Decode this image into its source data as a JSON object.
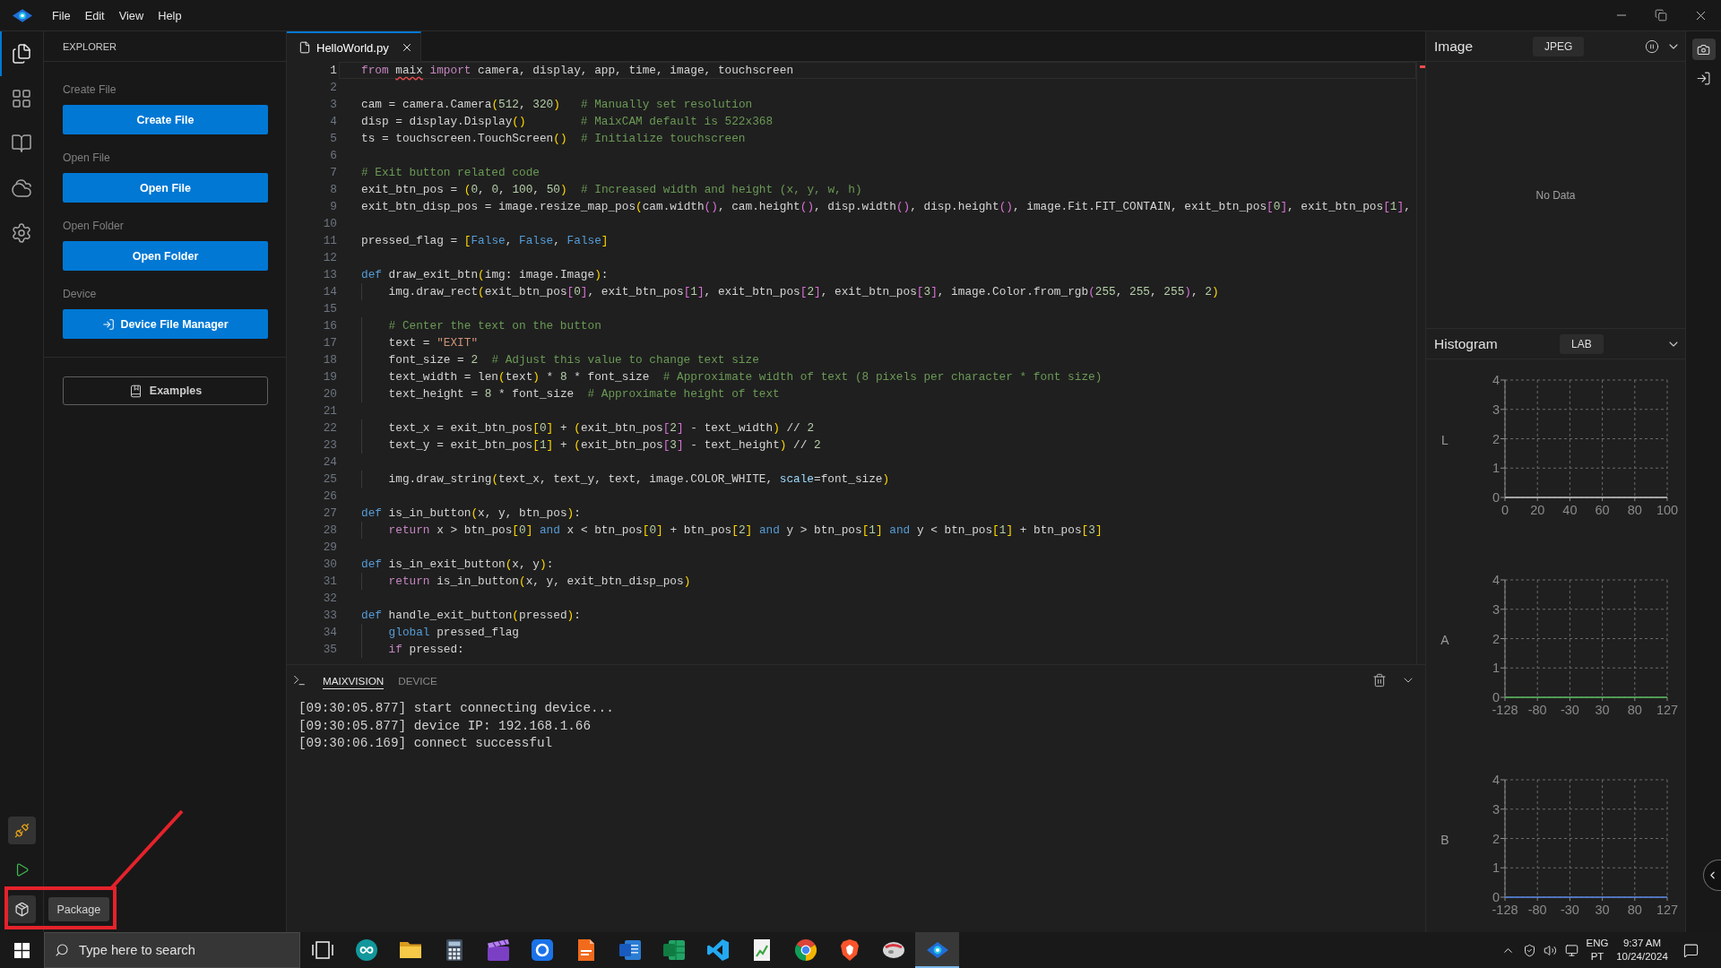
{
  "menu_bar": {
    "items": [
      "File",
      "Edit",
      "View",
      "Help"
    ]
  },
  "activity_bar": {
    "items": [
      {
        "kind": "files",
        "selected": true
      },
      {
        "kind": "grid",
        "selected": false
      },
      {
        "kind": "book",
        "selected": false
      },
      {
        "kind": "cloud",
        "selected": false
      },
      {
        "kind": "settings",
        "selected": false
      }
    ],
    "bottom_items": [
      {
        "kind": "connect",
        "highlighted": true
      },
      {
        "kind": "run",
        "highlighted": false
      },
      {
        "kind": "package",
        "highlighted": true,
        "tooltip": "Package"
      }
    ]
  },
  "explorer": {
    "title": "EXPLORER",
    "sections": [
      {
        "label": "Create File",
        "button": "Create File",
        "kind": "plain"
      },
      {
        "label": "Open File",
        "button": "Open File",
        "kind": "plain"
      },
      {
        "label": "Open Folder",
        "button": "Open Folder",
        "kind": "plain"
      },
      {
        "label": "Device",
        "button": "Device File Manager",
        "kind": "with-icon"
      }
    ],
    "examples_button": "Examples"
  },
  "editor": {
    "tabs": [
      {
        "label": "HelloWorld.py",
        "selected": true
      }
    ],
    "lines": [
      {
        "number": "1",
        "active": true,
        "tokens": [
          {
            "kind": "control",
            "text": "from "
          },
          {
            "kind": "unresolved",
            "text": "maix"
          },
          {
            "kind": "control",
            "text": " import"
          },
          {
            "kind": "plain",
            "text": " camera, display, app, time, image, touchscreen"
          }
        ]
      },
      {
        "number": "2",
        "active": false
      },
      {
        "number": "3",
        "active": false,
        "tokens": [
          {
            "kind": "plain",
            "text": "cam = camera.Camera("
          },
          {
            "kind": "number",
            "text": "512"
          },
          {
            "kind": "plain",
            "text": ", "
          },
          {
            "kind": "number",
            "text": "320"
          },
          {
            "kind": "plain",
            "text": ")   "
          },
          {
            "kind": "comment",
            "text": "# Manually set resolution"
          }
        ]
      },
      {
        "number": "4",
        "active": false,
        "tokens": [
          {
            "kind": "plain",
            "text": "disp = display.Display()        "
          },
          {
            "kind": "comment",
            "text": "# MaixCAM default is 522x368"
          }
        ]
      },
      {
        "number": "5",
        "active": false,
        "tokens": [
          {
            "kind": "plain",
            "text": "ts = touchscreen.TouchScreen()  "
          },
          {
            "kind": "comment",
            "text": "# Initialize touchscreen"
          }
        ]
      },
      {
        "number": "6",
        "active": false
      },
      {
        "number": "7",
        "active": false,
        "tokens": [
          {
            "kind": "comment",
            "text": "# Exit button related code"
          }
        ]
      },
      {
        "number": "8",
        "active": false,
        "tokens": [
          {
            "kind": "plain",
            "text": "exit_btn_pos = ("
          },
          {
            "kind": "number",
            "text": "0"
          },
          {
            "kind": "plain",
            "text": ", "
          },
          {
            "kind": "number",
            "text": "0"
          },
          {
            "kind": "plain",
            "text": ", "
          },
          {
            "kind": "number",
            "text": "100"
          },
          {
            "kind": "plain",
            "text": ", "
          },
          {
            "kind": "number",
            "text": "50"
          },
          {
            "kind": "plain",
            "text": ")  "
          },
          {
            "kind": "comment",
            "text": "# Increased width and height (x, y, w, h)"
          }
        ]
      },
      {
        "number": "9",
        "active": false,
        "tokens": [
          {
            "kind": "plain",
            "text": "exit_btn_disp_pos = image.resize_map_pos(cam.width(), cam.height(), disp.width(), disp.height(), image.Fit.FIT_CONTAIN, exit_btn_pos["
          },
          {
            "kind": "number",
            "text": "0"
          },
          {
            "kind": "plain",
            "text": "], exit_btn_pos["
          },
          {
            "kind": "number",
            "text": "1"
          },
          {
            "kind": "plain",
            "text": "],"
          }
        ]
      },
      {
        "number": "10",
        "active": false
      },
      {
        "number": "11",
        "active": false,
        "tokens": [
          {
            "kind": "plain",
            "text": "pressed_flag = ["
          },
          {
            "kind": "keyword",
            "text": "False"
          },
          {
            "kind": "plain",
            "text": ", "
          },
          {
            "kind": "keyword",
            "text": "False"
          },
          {
            "kind": "plain",
            "text": ", "
          },
          {
            "kind": "keyword",
            "text": "False"
          },
          {
            "kind": "plain",
            "text": "]"
          }
        ]
      },
      {
        "number": "12",
        "active": false
      },
      {
        "number": "13",
        "active": false,
        "tokens": [
          {
            "kind": "keyword",
            "text": "def"
          },
          {
            "kind": "plain",
            "text": " draw_exit_btn(img: image.Image):"
          }
        ]
      },
      {
        "number": "14",
        "active": false,
        "tokens": [
          {
            "kind": "plain",
            "text": "    img.draw_rect(exit_btn_pos["
          },
          {
            "kind": "number",
            "text": "0"
          },
          {
            "kind": "plain",
            "text": "], exit_btn_pos["
          },
          {
            "kind": "number",
            "text": "1"
          },
          {
            "kind": "plain",
            "text": "], exit_btn_pos["
          },
          {
            "kind": "number",
            "text": "2"
          },
          {
            "kind": "plain",
            "text": "], exit_btn_pos["
          },
          {
            "kind": "number",
            "text": "3"
          },
          {
            "kind": "plain",
            "text": "], image.Color.from_rgb("
          },
          {
            "kind": "number",
            "text": "255"
          },
          {
            "kind": "plain",
            "text": ", "
          },
          {
            "kind": "number",
            "text": "255"
          },
          {
            "kind": "plain",
            "text": ", "
          },
          {
            "kind": "number",
            "text": "255"
          },
          {
            "kind": "plain",
            "text": "), "
          },
          {
            "kind": "number",
            "text": "2"
          },
          {
            "kind": "plain",
            "text": ")"
          }
        ]
      },
      {
        "number": "15",
        "active": false
      },
      {
        "number": "16",
        "active": false,
        "tokens": [
          {
            "kind": "comment",
            "text": "    # Center the text on the button"
          }
        ]
      },
      {
        "number": "17",
        "active": false,
        "tokens": [
          {
            "kind": "plain",
            "text": "    text = "
          },
          {
            "kind": "string",
            "text": "\"EXIT\""
          }
        ]
      },
      {
        "number": "18",
        "active": false,
        "tokens": [
          {
            "kind": "plain",
            "text": "    font_size = "
          },
          {
            "kind": "number",
            "text": "2"
          },
          {
            "kind": "comment",
            "text": "  # Adjust this value to change text size"
          }
        ]
      },
      {
        "number": "19",
        "active": false,
        "tokens": [
          {
            "kind": "plain",
            "text": "    text_width = len(text) * "
          },
          {
            "kind": "number",
            "text": "8"
          },
          {
            "kind": "plain",
            "text": " * font_size  "
          },
          {
            "kind": "comment",
            "text": "# Approximate width of text (8 pixels per character * font size)"
          }
        ]
      },
      {
        "number": "20",
        "active": false,
        "tokens": [
          {
            "kind": "plain",
            "text": "    text_height = "
          },
          {
            "kind": "number",
            "text": "8"
          },
          {
            "kind": "plain",
            "text": " * font_size  "
          },
          {
            "kind": "comment",
            "text": "# Approximate height of text"
          }
        ]
      },
      {
        "number": "21",
        "active": false
      },
      {
        "number": "22",
        "active": false,
        "tokens": [
          {
            "kind": "plain",
            "text": "    text_x = exit_btn_pos["
          },
          {
            "kind": "number",
            "text": "0"
          },
          {
            "kind": "plain",
            "text": "] + (exit_btn_pos["
          },
          {
            "kind": "number",
            "text": "2"
          },
          {
            "kind": "plain",
            "text": "] - text_width) // "
          },
          {
            "kind": "number",
            "text": "2"
          }
        ]
      },
      {
        "number": "23",
        "active": false,
        "tokens": [
          {
            "kind": "plain",
            "text": "    text_y = exit_btn_pos["
          },
          {
            "kind": "number",
            "text": "1"
          },
          {
            "kind": "plain",
            "text": "] + (exit_btn_pos["
          },
          {
            "kind": "number",
            "text": "3"
          },
          {
            "kind": "plain",
            "text": "] - text_height) // "
          },
          {
            "kind": "number",
            "text": "2"
          }
        ]
      },
      {
        "number": "24",
        "active": false
      },
      {
        "number": "25",
        "active": false,
        "tokens": [
          {
            "kind": "plain",
            "text": "    img.draw_string(text_x, text_y, text, image.COLOR_WHITE, "
          },
          {
            "kind": "param",
            "text": "scale"
          },
          {
            "kind": "plain",
            "text": "=font_size)"
          }
        ]
      },
      {
        "number": "26",
        "active": false
      },
      {
        "number": "27",
        "active": false,
        "tokens": [
          {
            "kind": "keyword",
            "text": "def"
          },
          {
            "kind": "plain",
            "text": " is_in_button(x, y, btn_pos):"
          }
        ]
      },
      {
        "number": "28",
        "active": false,
        "tokens": [
          {
            "kind": "control",
            "text": "    return"
          },
          {
            "kind": "plain",
            "text": " x > btn_pos["
          },
          {
            "kind": "number",
            "text": "0"
          },
          {
            "kind": "plain",
            "text": "] "
          },
          {
            "kind": "keyword",
            "text": "and"
          },
          {
            "kind": "plain",
            "text": " x < btn_pos["
          },
          {
            "kind": "number",
            "text": "0"
          },
          {
            "kind": "plain",
            "text": "] + btn_pos["
          },
          {
            "kind": "number",
            "text": "2"
          },
          {
            "kind": "plain",
            "text": "] "
          },
          {
            "kind": "keyword",
            "text": "and"
          },
          {
            "kind": "plain",
            "text": " y > btn_pos["
          },
          {
            "kind": "number",
            "text": "1"
          },
          {
            "kind": "plain",
            "text": "] "
          },
          {
            "kind": "keyword",
            "text": "and"
          },
          {
            "kind": "plain",
            "text": " y < btn_pos["
          },
          {
            "kind": "number",
            "text": "1"
          },
          {
            "kind": "plain",
            "text": "] + btn_pos["
          },
          {
            "kind": "number",
            "text": "3"
          },
          {
            "kind": "plain",
            "text": "]"
          }
        ]
      },
      {
        "number": "29",
        "active": false
      },
      {
        "number": "30",
        "active": false,
        "tokens": [
          {
            "kind": "keyword",
            "text": "def"
          },
          {
            "kind": "plain",
            "text": " is_in_exit_button(x, y):"
          }
        ]
      },
      {
        "number": "31",
        "active": false,
        "tokens": [
          {
            "kind": "control",
            "text": "    return"
          },
          {
            "kind": "plain",
            "text": " is_in_button(x, y, exit_btn_disp_pos)"
          }
        ]
      },
      {
        "number": "32",
        "active": false
      },
      {
        "number": "33",
        "active": false,
        "tokens": [
          {
            "kind": "keyword",
            "text": "def"
          },
          {
            "kind": "plain",
            "text": " handle_exit_button(pressed):"
          }
        ]
      },
      {
        "number": "34",
        "active": false,
        "tokens": [
          {
            "kind": "keyword",
            "text": "    global"
          },
          {
            "kind": "plain",
            "text": " pressed_flag"
          }
        ]
      },
      {
        "number": "35",
        "active": false,
        "tokens": [
          {
            "kind": "control",
            "text": "    if"
          },
          {
            "kind": "plain",
            "text": " pressed:"
          }
        ]
      }
    ]
  },
  "terminal": {
    "tabs": [
      {
        "label": "MAIXVISION",
        "selected": true
      },
      {
        "label": "DEVICE",
        "selected": false
      }
    ],
    "lines": [
      "[09:30:05.877] start connecting device...",
      "[09:30:05.877] device IP: 192.168.1.66",
      "[09:30:06.169] connect successful"
    ]
  },
  "image_panel": {
    "title": "Image",
    "format": "JPEG",
    "message": "No Data"
  },
  "histogram_panel": {
    "title": "Histogram",
    "mode": "LAB",
    "charts": [
      {
        "chart_data": {
          "type": "line",
          "ylabel": "L",
          "categories": [
            "0",
            "20",
            "40",
            "60",
            "80",
            "100"
          ],
          "series": [
            {
              "color": "#bdbdbd",
              "values": [
                0,
                0,
                0,
                0,
                0,
                0
              ]
            }
          ],
          "ylim": [
            0,
            4
          ],
          "yticks": [
            0,
            1,
            2,
            3,
            4
          ],
          "grid": true
        }
      },
      {
        "chart_data": {
          "type": "line",
          "ylabel": "A",
          "categories": [
            "-128",
            "-80",
            "-30",
            "30",
            "80",
            "127"
          ],
          "series": [
            {
              "color": "#4caf50",
              "values": [
                0,
                0,
                0,
                0,
                0,
                0
              ]
            }
          ],
          "ylim": [
            0,
            4
          ],
          "yticks": [
            0,
            1,
            2,
            3,
            4
          ],
          "grid": true
        }
      },
      {
        "chart_data": {
          "type": "line",
          "ylabel": "B",
          "categories": [
            "-128",
            "-80",
            "-30",
            "30",
            "80",
            "127"
          ],
          "series": [
            {
              "color": "#4a7bd8",
              "values": [
                0,
                0,
                0,
                0,
                0,
                0
              ]
            }
          ],
          "ylim": [
            0,
            4
          ],
          "yticks": [
            0,
            1,
            2,
            3,
            4
          ],
          "grid": true
        }
      }
    ]
  },
  "callout": {
    "kind": "frame-and-line"
  },
  "taskbar": {
    "search": {
      "placeholder": "Type here to search"
    },
    "apps": [
      {
        "kind": "task-view",
        "selected": false
      },
      {
        "kind": "infinity",
        "selected": false
      },
      {
        "kind": "folder",
        "selected": false
      },
      {
        "kind": "calculator",
        "selected": false
      },
      {
        "kind": "clapperboard",
        "selected": false
      },
      {
        "kind": "ring",
        "selected": false
      },
      {
        "kind": "document",
        "selected": false
      },
      {
        "kind": "word-doc",
        "selected": false
      },
      {
        "kind": "spreadsheet",
        "selected": false
      },
      {
        "kind": "ribbon",
        "selected": false
      },
      {
        "kind": "chart-sheet",
        "selected": false
      },
      {
        "kind": "segmented-circle",
        "selected": false
      },
      {
        "kind": "shield",
        "selected": false
      },
      {
        "kind": "oval",
        "selected": false
      },
      {
        "kind": "eye",
        "selected": true
      }
    ],
    "tray": {
      "language": "ENG",
      "layout": "PT",
      "time": "9:37 AM",
      "date": "10/24/2024"
    }
  }
}
